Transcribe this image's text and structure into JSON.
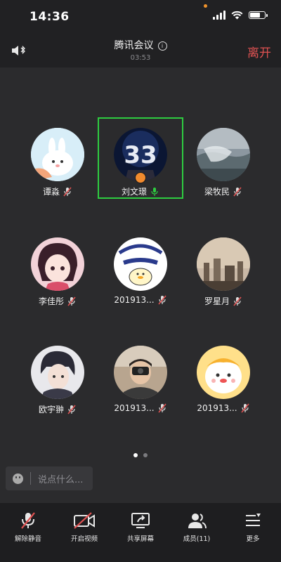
{
  "status_bar": {
    "time": "14:36"
  },
  "header": {
    "title": "腾讯会议",
    "duration": "03:53",
    "leave_label": "离开"
  },
  "participants": [
    {
      "name": "谭淼",
      "mic": "muted"
    },
    {
      "name": "刘文璟",
      "mic": "on",
      "active": true
    },
    {
      "name": "梁牧民",
      "mic": "muted"
    },
    {
      "name": "李佳彤",
      "mic": "muted"
    },
    {
      "name": "201913...",
      "mic": "muted"
    },
    {
      "name": "罗星月",
      "mic": "muted"
    },
    {
      "name": "欧宇翀",
      "mic": "muted"
    },
    {
      "name": "201913...",
      "mic": "muted"
    },
    {
      "name": "201913...",
      "mic": "muted"
    }
  ],
  "pagination": {
    "current": 1,
    "total": 2
  },
  "chat": {
    "placeholder": "说点什么..."
  },
  "toolbar": {
    "unmute_label": "解除静音",
    "video_label": "开启视频",
    "share_label": "共享屏幕",
    "members_label": "成员(11)",
    "more_label": "更多"
  },
  "colors": {
    "leave": "#e05252",
    "active_border": "#2ecc40",
    "mic_off": "#e05252",
    "mic_on": "#2ecc40"
  }
}
